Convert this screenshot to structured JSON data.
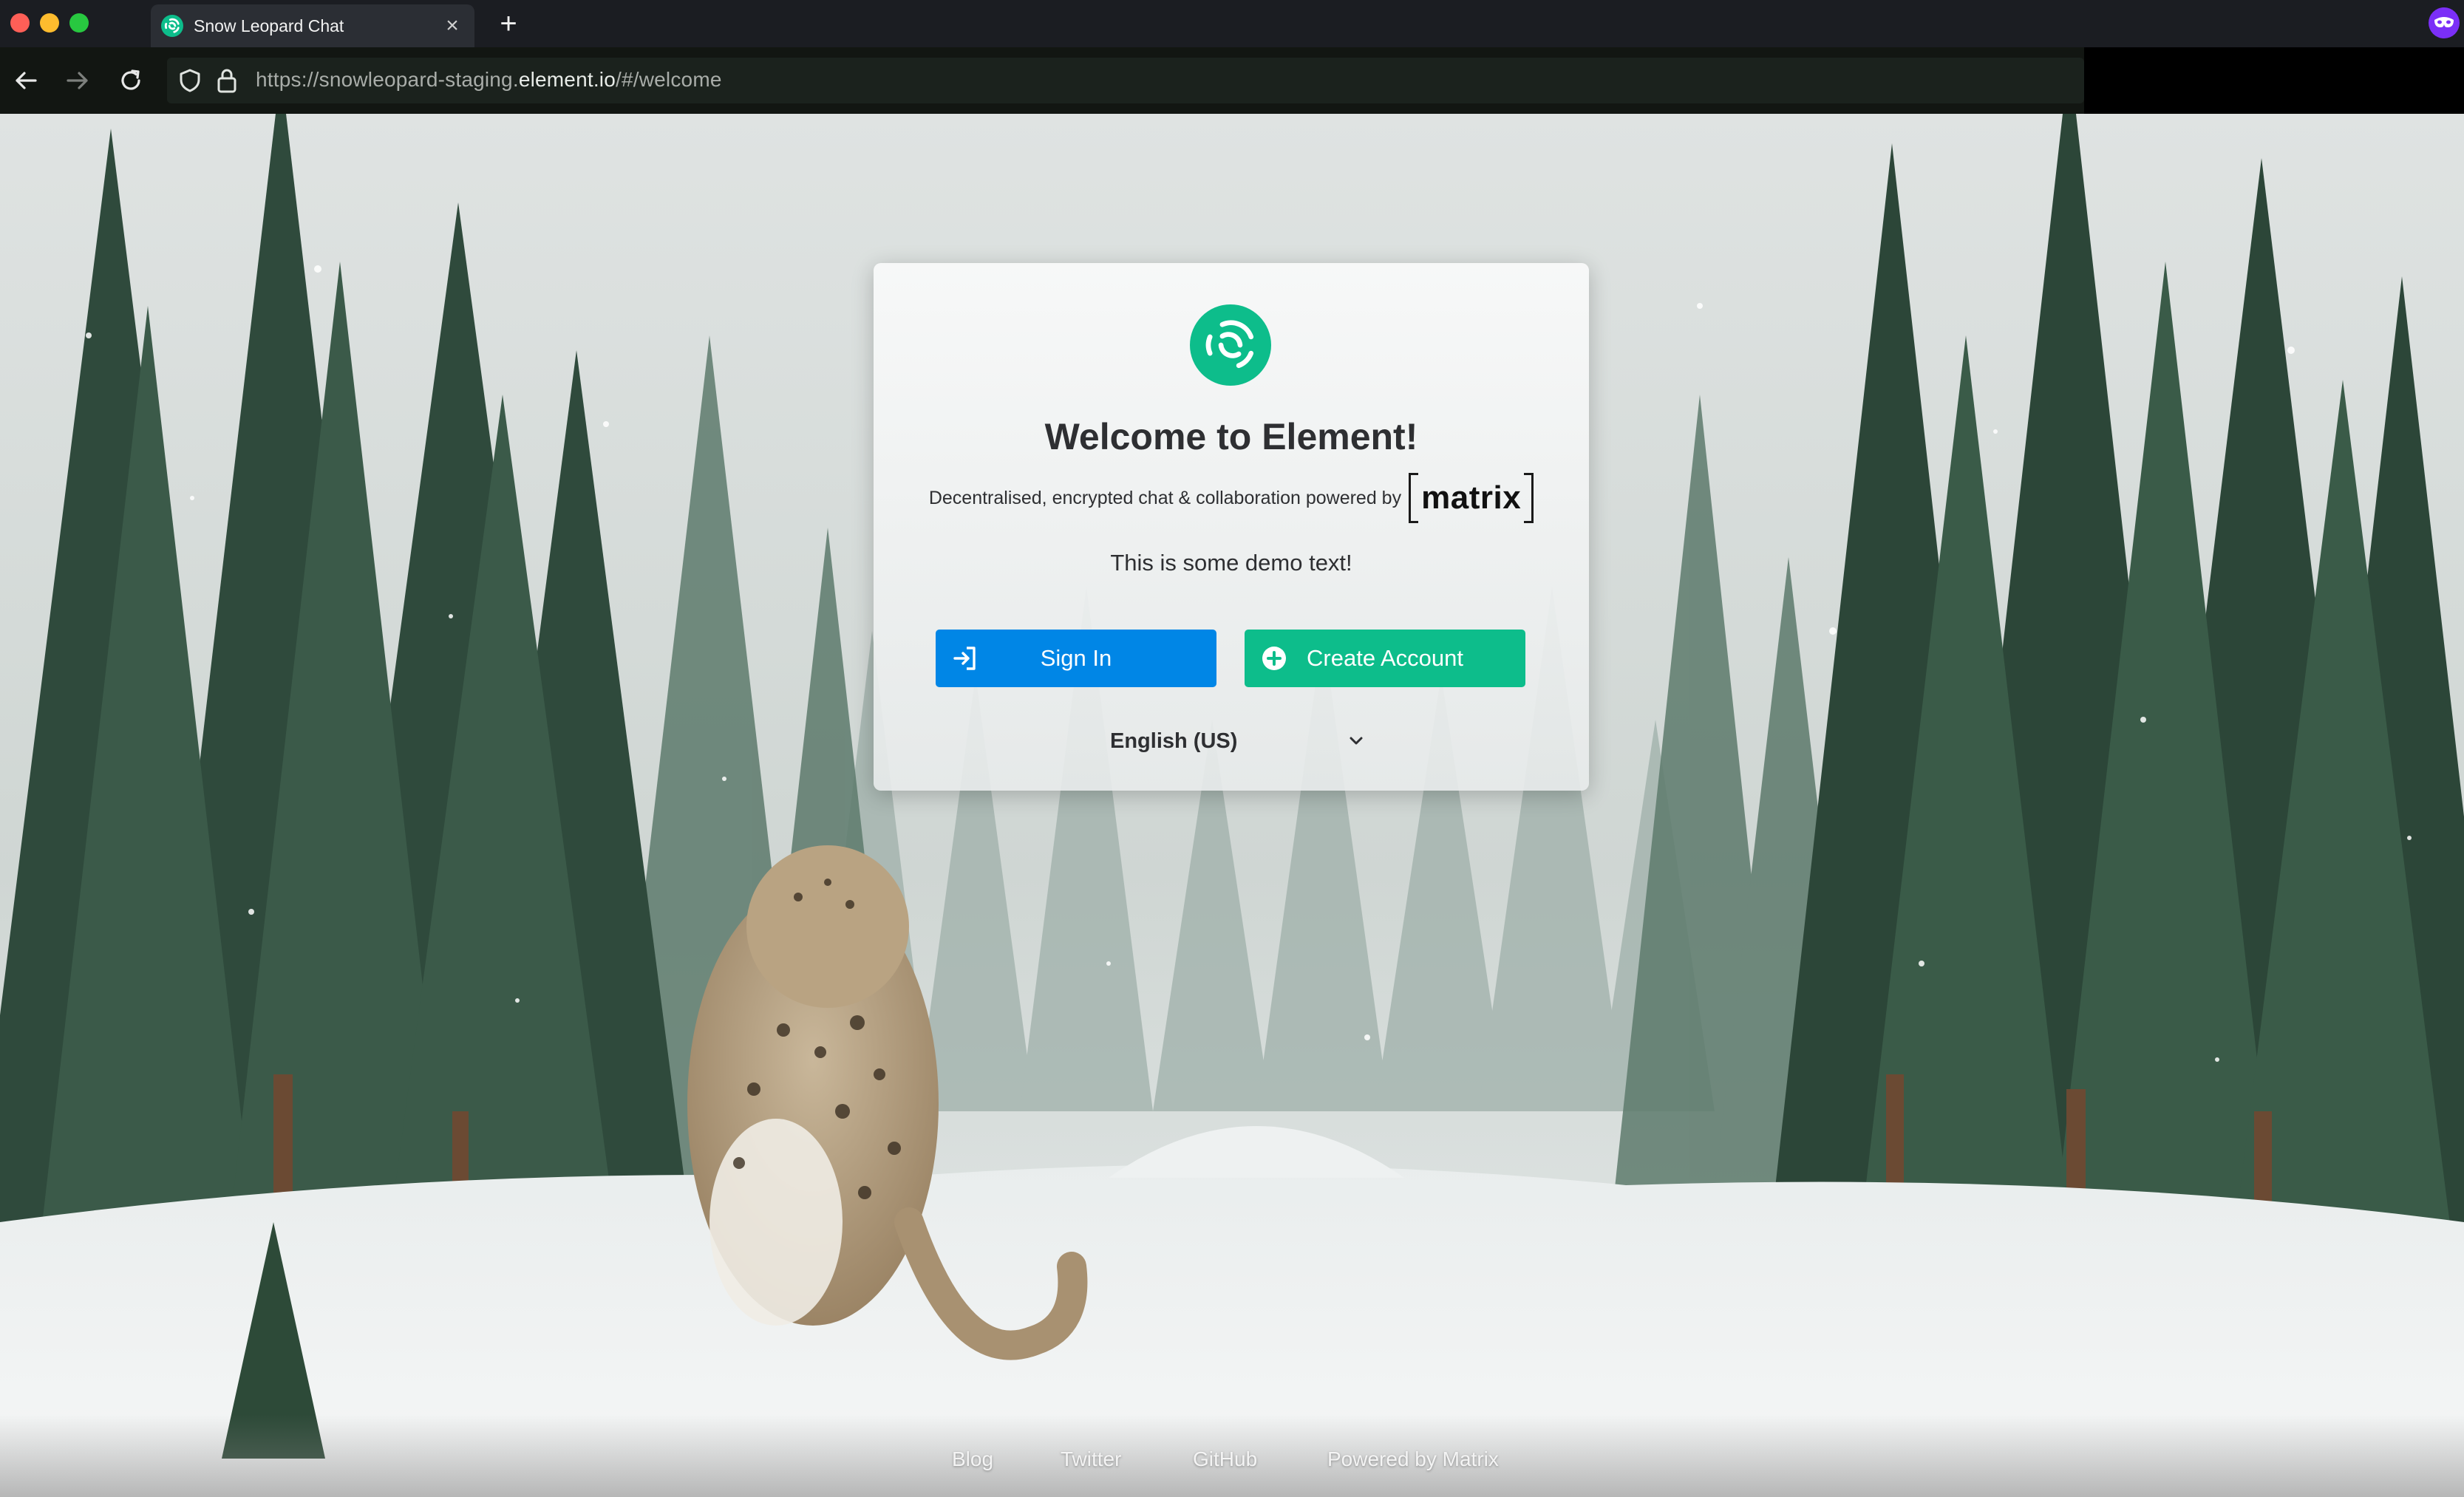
{
  "browser": {
    "tab_title": "Snow Leopard Chat",
    "new_tab_label": "+",
    "close_tab_label": "×",
    "url_prefix": "https://snowleopard-staging.",
    "url_host": "element.io",
    "url_suffix": "/#/welcome"
  },
  "card": {
    "title": "Welcome to Element!",
    "tagline": "Decentralised, encrypted chat & collaboration powered by",
    "matrix_wordmark": "matrix",
    "demo_text": "This is some demo text!",
    "sign_in_label": "Sign In",
    "create_account_label": "Create Account",
    "language": "English (US)"
  },
  "footer": {
    "links": [
      "Blog",
      "Twitter",
      "GitHub",
      "Powered by Matrix"
    ]
  },
  "colors": {
    "element_green": "#0dbd8b",
    "sign_in_blue": "#0086e6"
  }
}
